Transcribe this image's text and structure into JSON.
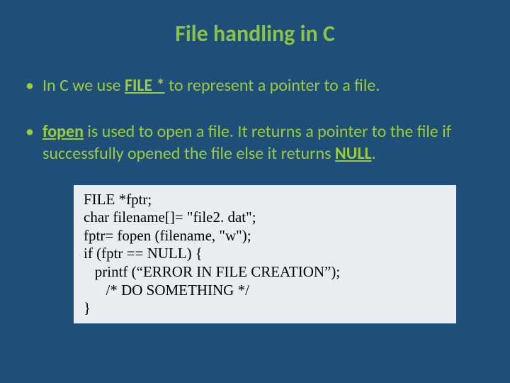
{
  "title": "File handling in C",
  "bullet1": {
    "pre": "In C we use ",
    "strong": "FILE *",
    "post": " to represent a pointer to a file."
  },
  "bullet2": {
    "strong1": "fopen",
    "mid": " is used to open a file.  It returns a pointer to the file if successfully opened the file else it returns ",
    "strong2": "NULL",
    "post": "."
  },
  "code": {
    "l1": "FILE *fptr;",
    "l2": "char filename[]= \"file2. dat\";",
    "l3": "fptr= fopen (filename, \"w\");",
    "l4": "if (fptr == NULL) {",
    "l5": "   printf (“ERROR IN FILE CREATION”);",
    "l6": "      /* DO SOMETHING */",
    "l7": "}"
  }
}
